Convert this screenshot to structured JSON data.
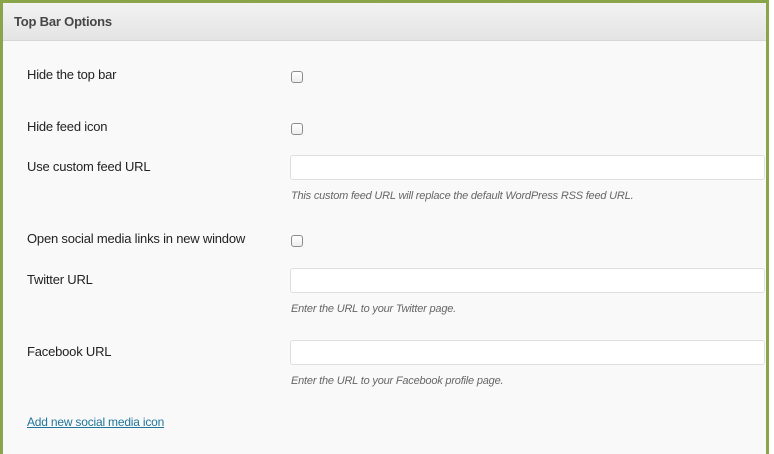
{
  "panel": {
    "title": "Top Bar Options"
  },
  "fields": {
    "hide_top_bar": {
      "label": "Hide the top bar",
      "checked": false
    },
    "hide_feed_icon": {
      "label": "Hide feed icon",
      "checked": false
    },
    "custom_feed_url": {
      "label": "Use custom feed URL",
      "value": "",
      "hint": "This custom feed URL will replace the default WordPress RSS feed URL."
    },
    "open_new_window": {
      "label": "Open social media links in new window",
      "checked": false
    },
    "twitter_url": {
      "label": "Twitter URL",
      "value": "",
      "hint": "Enter the URL to your Twitter page."
    },
    "facebook_url": {
      "label": "Facebook URL",
      "value": "",
      "hint": "Enter the URL to your Facebook profile page."
    }
  },
  "actions": {
    "add_social_icon": "Add new social media icon"
  },
  "colors": {
    "frame_border": "#8aa44a",
    "link": "#21759b"
  }
}
